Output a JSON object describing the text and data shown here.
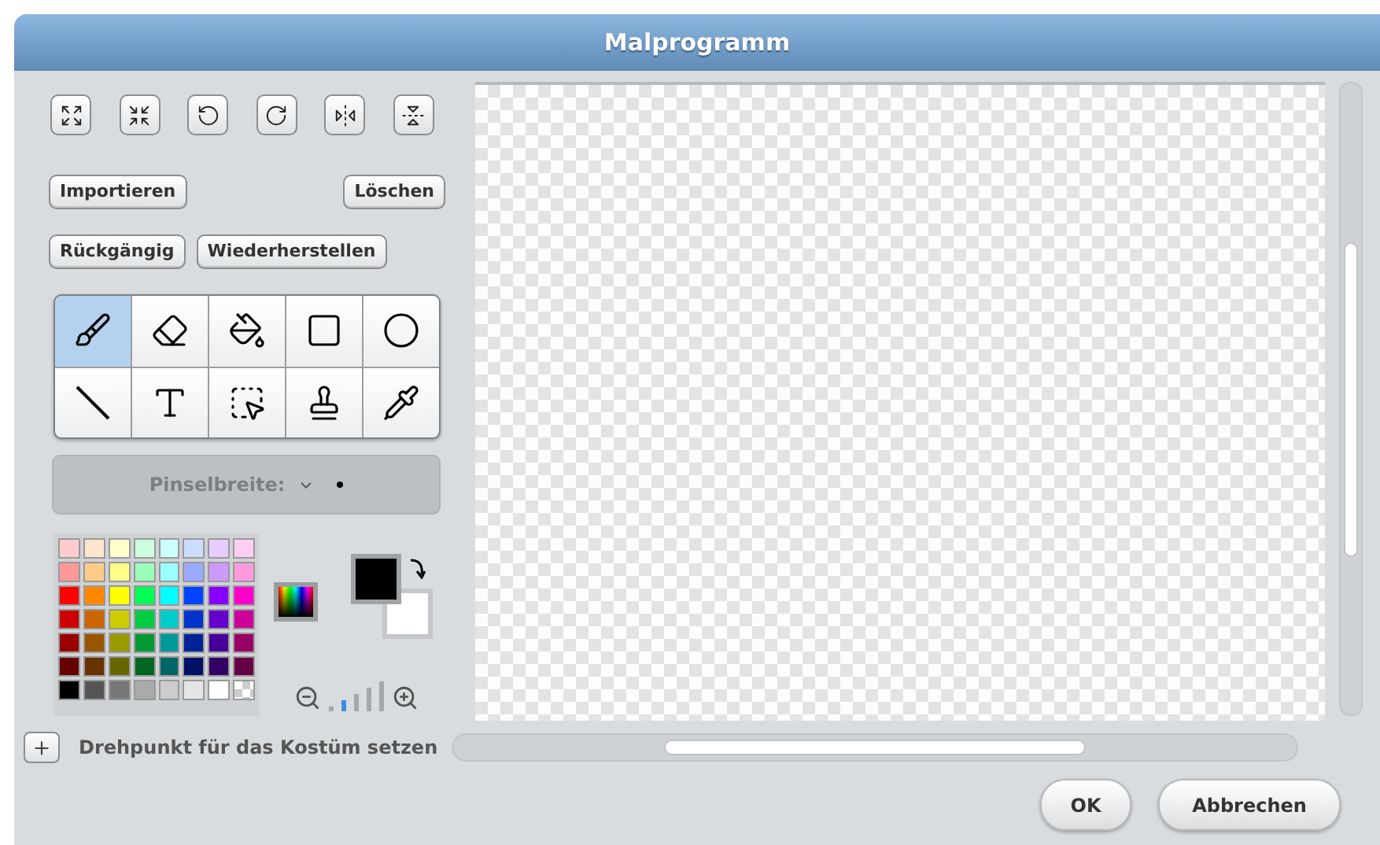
{
  "window": {
    "title": "Malprogramm"
  },
  "transform_buttons": [
    {
      "kind": "grow"
    },
    {
      "kind": "shrink"
    },
    {
      "kind": "rotate-left"
    },
    {
      "kind": "rotate-right"
    },
    {
      "kind": "flip-horizontal"
    },
    {
      "kind": "flip-vertical"
    }
  ],
  "file_buttons": [
    {
      "label": "Importieren"
    },
    {
      "label": "Löschen"
    }
  ],
  "history_buttons": [
    {
      "label": "Rückgängig"
    },
    {
      "label": "Wiederherstellen"
    }
  ],
  "tools": [
    {
      "kind": "brush",
      "selected": true
    },
    {
      "kind": "eraser",
      "selected": false
    },
    {
      "kind": "fill",
      "selected": false
    },
    {
      "kind": "rectangle",
      "selected": false
    },
    {
      "kind": "ellipse",
      "selected": false
    },
    {
      "kind": "line",
      "selected": false
    },
    {
      "kind": "text",
      "selected": false
    },
    {
      "kind": "select",
      "selected": false
    },
    {
      "kind": "stamp",
      "selected": false
    },
    {
      "kind": "eyedropper",
      "selected": false
    }
  ],
  "brush_width": {
    "label": "Pinselbreite:"
  },
  "palette": [
    [
      {
        "kind": "solid",
        "color": "#ffcccc"
      },
      {
        "kind": "solid",
        "color": "#ffe6cc"
      },
      {
        "kind": "solid",
        "color": "#ffffcc"
      },
      {
        "kind": "solid",
        "color": "#ccffdd"
      },
      {
        "kind": "solid",
        "color": "#ccffff"
      },
      {
        "kind": "solid",
        "color": "#ccddff"
      },
      {
        "kind": "solid",
        "color": "#e6ccff"
      },
      {
        "kind": "solid",
        "color": "#ffccf2"
      }
    ],
    [
      {
        "kind": "solid",
        "color": "#ff9999"
      },
      {
        "kind": "solid",
        "color": "#ffcc88"
      },
      {
        "kind": "solid",
        "color": "#ffff88"
      },
      {
        "kind": "solid",
        "color": "#99ffbb"
      },
      {
        "kind": "solid",
        "color": "#99ffff"
      },
      {
        "kind": "solid",
        "color": "#99aaff"
      },
      {
        "kind": "solid",
        "color": "#cc99ff"
      },
      {
        "kind": "solid",
        "color": "#ff99dd"
      }
    ],
    [
      {
        "kind": "solid",
        "color": "#ff0000"
      },
      {
        "kind": "solid",
        "color": "#ff8800"
      },
      {
        "kind": "solid",
        "color": "#ffff00"
      },
      {
        "kind": "solid",
        "color": "#00ff55"
      },
      {
        "kind": "solid",
        "color": "#00ffff"
      },
      {
        "kind": "solid",
        "color": "#0044ff"
      },
      {
        "kind": "solid",
        "color": "#8800ff"
      },
      {
        "kind": "solid",
        "color": "#ff00cc"
      }
    ],
    [
      {
        "kind": "solid",
        "color": "#cc0000"
      },
      {
        "kind": "solid",
        "color": "#cc6600"
      },
      {
        "kind": "solid",
        "color": "#cccc00"
      },
      {
        "kind": "solid",
        "color": "#00cc44"
      },
      {
        "kind": "solid",
        "color": "#00cccc"
      },
      {
        "kind": "solid",
        "color": "#0033cc"
      },
      {
        "kind": "solid",
        "color": "#6600cc"
      },
      {
        "kind": "solid",
        "color": "#cc0099"
      }
    ],
    [
      {
        "kind": "solid",
        "color": "#990000"
      },
      {
        "kind": "solid",
        "color": "#995500"
      },
      {
        "kind": "solid",
        "color": "#999900"
      },
      {
        "kind": "solid",
        "color": "#009933"
      },
      {
        "kind": "solid",
        "color": "#009999"
      },
      {
        "kind": "solid",
        "color": "#002299"
      },
      {
        "kind": "solid",
        "color": "#440099"
      },
      {
        "kind": "solid",
        "color": "#990066"
      }
    ],
    [
      {
        "kind": "solid",
        "color": "#660000"
      },
      {
        "kind": "solid",
        "color": "#663300"
      },
      {
        "kind": "solid",
        "color": "#666600"
      },
      {
        "kind": "solid",
        "color": "#006622"
      },
      {
        "kind": "solid",
        "color": "#006666"
      },
      {
        "kind": "solid",
        "color": "#001166"
      },
      {
        "kind": "solid",
        "color": "#330066"
      },
      {
        "kind": "solid",
        "color": "#660044"
      }
    ],
    [
      {
        "kind": "solid",
        "color": "#000000"
      },
      {
        "kind": "solid",
        "color": "#555555"
      },
      {
        "kind": "solid",
        "color": "#777777"
      },
      {
        "kind": "solid",
        "color": "#aaaaaa"
      },
      {
        "kind": "solid",
        "color": "#cccccc"
      },
      {
        "kind": "solid",
        "color": "#e6e6e6"
      },
      {
        "kind": "solid",
        "color": "#ffffff"
      },
      {
        "kind": "transparent"
      }
    ]
  ],
  "foreground": {
    "color": "#000000"
  },
  "background": {
    "color": "#ffffff"
  },
  "zoom_steps": [
    {
      "selected": false
    },
    {
      "selected": true
    },
    {
      "selected": false
    },
    {
      "selected": false
    },
    {
      "selected": false
    }
  ],
  "rotation_center": {
    "label": "Drehpunkt für das Kostüm setzen"
  },
  "dialog_buttons": [
    {
      "label": "OK"
    },
    {
      "label": "Abbrechen"
    }
  ]
}
